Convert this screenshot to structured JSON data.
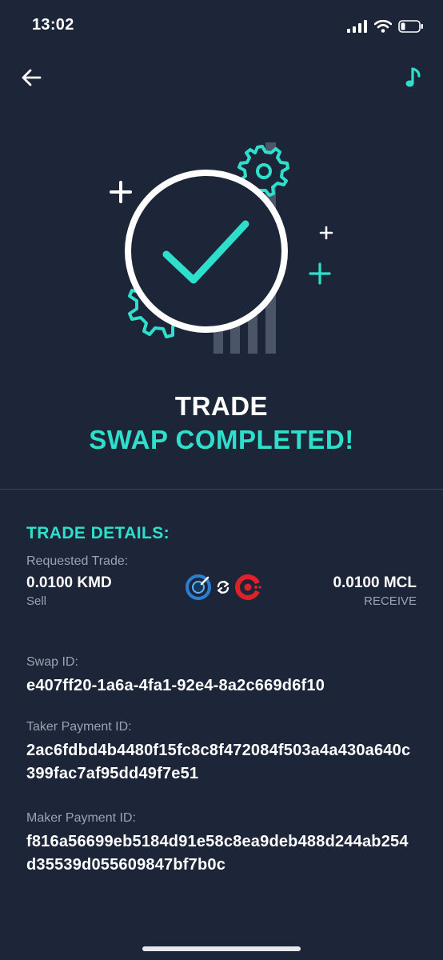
{
  "status_bar": {
    "time": "13:02"
  },
  "colors": {
    "background": "#1d2638",
    "accent": "#2ee0cc",
    "muted_text": "#9aa3b2",
    "kmd_blue": "#2a7fd0",
    "mcl_red": "#e0212a"
  },
  "icons": {
    "back": "arrow-left-icon",
    "music": "music-note-icon",
    "swap": "swap-arrows-icon"
  },
  "header": {
    "line1": "TRADE",
    "line2": "SWAP COMPLETED!"
  },
  "details": {
    "section_title": "TRADE DETAILS:",
    "requested_label": "Requested Trade:",
    "sell_amount": "0.0100 KMD",
    "sell_label": "Sell",
    "receive_amount": "0.0100 MCL",
    "receive_label": "RECEIVE",
    "swap_id_label": "Swap ID:",
    "swap_id": "e407ff20-1a6a-4fa1-92e4-8a2c669d6f10",
    "taker_label": "Taker Payment ID:",
    "taker_id": "2ac6fdbd4b4480f15fc8c8f472084f503a4a430a640c399fac7af95dd49f7e51",
    "maker_label": "Maker Payment ID:",
    "maker_id": "f816a56699eb5184d91e58c8ea9deb488d244ab254d35539d055609847bf7b0c"
  }
}
